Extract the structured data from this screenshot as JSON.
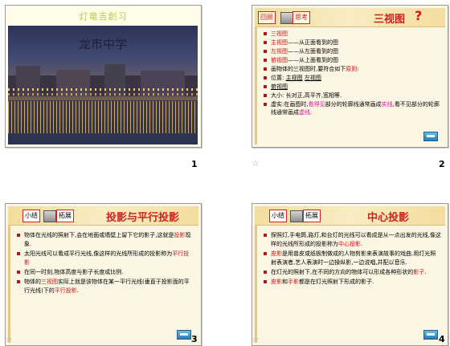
{
  "slides": [
    {
      "number": "1",
      "title": "灯竜吉創习",
      "photo_caption": "龙市中学"
    },
    {
      "number": "2",
      "tag": "回顾",
      "tag2": "思考",
      "title": "三视图",
      "title_mark": "?",
      "items": [
        {
          "parts": [
            {
              "t": "三视图",
              "c": "red"
            }
          ]
        },
        {
          "parts": [
            {
              "t": "主视图",
              "c": "red"
            },
            {
              "t": "——从正面看到的图"
            }
          ]
        },
        {
          "parts": [
            {
              "t": "左视图",
              "c": "red"
            },
            {
              "t": "——从左面看到的图"
            }
          ]
        },
        {
          "parts": [
            {
              "t": "俯视图",
              "c": "red"
            },
            {
              "t": "——从上面看到的图"
            }
          ]
        },
        {
          "parts": [
            {
              "t": "画物体的三视图时,要符合如下"
            },
            {
              "t": "原则",
              "c": "red"
            },
            {
              "t": ":"
            }
          ]
        },
        {
          "parts": [
            {
              "t": "位置: "
            },
            {
              "t": "主视图",
              "c": "ul"
            },
            {
              "t": "  "
            },
            {
              "t": "左视图",
              "c": "ul"
            }
          ]
        },
        {
          "parts": [
            {
              "t": "          "
            },
            {
              "t": "俯视图",
              "c": "ul"
            }
          ]
        },
        {
          "parts": [
            {
              "t": "大小: 长对正,高平齐,宽相等."
            }
          ]
        },
        {
          "parts": [
            {
              "t": "虚实:在画图时,"
            },
            {
              "t": "看得见",
              "c": "mag"
            },
            {
              "t": "部分的轮廓线通常画成"
            },
            {
              "t": "实线",
              "c": "mag"
            },
            {
              "t": ",看不见部分的轮廓线通常画成"
            },
            {
              "t": "虚线",
              "c": "mag"
            },
            {
              "t": "."
            }
          ]
        }
      ]
    },
    {
      "number": "3",
      "tag": "小结",
      "tag2": "拓展",
      "title": "投影与平行投影",
      "items": [
        {
          "parts": [
            {
              "t": "物体在光线的照射下,会在地面或墙壁上留下它的影子,这就是"
            },
            {
              "t": "投影",
              "c": "red"
            },
            {
              "t": "现象."
            }
          ]
        },
        {
          "parts": [
            {
              "t": "太阳光线可以看成平行光线,像这样的光线所形成的投影称为"
            },
            {
              "t": "平行投影",
              "c": "red"
            }
          ]
        },
        {
          "parts": [
            {
              "t": "在同一时刻,物体高度与影子长度成比例."
            }
          ]
        },
        {
          "parts": [
            {
              "t": "物体的"
            },
            {
              "t": "三视图",
              "c": "red"
            },
            {
              "t": "实际上就是该物体在某一平行光线(垂直于投影面的平行光线)下的"
            },
            {
              "t": "平行投影",
              "c": "red"
            },
            {
              "t": "."
            }
          ]
        }
      ]
    },
    {
      "number": "4",
      "tag": "小结",
      "tag2": "拓展",
      "title": "中心投影",
      "items": [
        {
          "parts": [
            {
              "t": "探照灯,手电筒,路灯,和台灯的光线可以看成是从一点出发的光线,像这样的光线所形成的投影称为"
            },
            {
              "t": "中心投影",
              "c": "red"
            },
            {
              "t": "."
            }
          ]
        },
        {
          "parts": [
            {
              "t": "皮影",
              "c": "red"
            },
            {
              "t": "是用兽皮或纸板制做成的人物剪影来表演故事的戏曲.用灯光照射表演者,艺人表演时一边操纵影,一边说唱,并配以音乐."
            }
          ]
        },
        {
          "parts": [
            {
              "t": "在灯光的照射下,在不同的方向的物体可以形成各种形状的"
            },
            {
              "t": "影子",
              "c": "red"
            },
            {
              "t": "."
            }
          ]
        },
        {
          "parts": [
            {
              "t": "皮影",
              "c": "red"
            },
            {
              "t": "和"
            },
            {
              "t": "手影",
              "c": "red"
            },
            {
              "t": "都是在灯光照射下形成的影子."
            }
          ]
        }
      ]
    }
  ],
  "colors": {
    "accent": "#cc2222",
    "magenta": "#dd11aa",
    "slide_bg": "#fbf6e4",
    "header": "#f3dd9e"
  },
  "icons": {
    "star": "star-icon",
    "nav": "next-slide-icon",
    "book": "book-icon"
  }
}
